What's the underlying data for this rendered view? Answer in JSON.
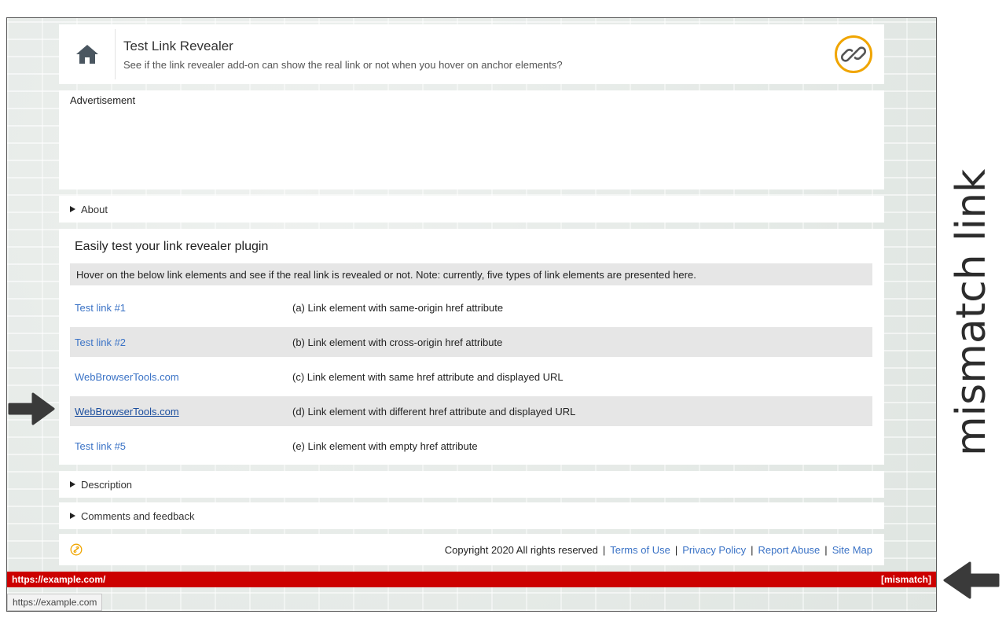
{
  "header": {
    "title": "Test Link Revealer",
    "subtitle": "See if the link revealer add-on can show the real link or not when you hover on anchor elements?",
    "home_icon": "home-icon",
    "logo_icon": "chain-link-icon"
  },
  "advertisement": {
    "label": "Advertisement"
  },
  "about": {
    "label": "About"
  },
  "main": {
    "title": "Easily test your link revealer plugin",
    "note": "Hover on the below link elements and see if the real link is revealed or not. Note: currently, five types of link elements are presented here.",
    "rows": [
      {
        "link": "Test link #1",
        "description": "(a) Link element with same-origin href attribute"
      },
      {
        "link": "Test link #2",
        "description": "(b) Link element with cross-origin href attribute"
      },
      {
        "link": "WebBrowserTools.com",
        "description": "(c) Link element with same href attribute and displayed URL"
      },
      {
        "link": "WebBrowserTools.com",
        "description": "(d) Link element with different href attribute and displayed URL"
      },
      {
        "link": "Test link #5",
        "description": "(e) Link element with empty href attribute"
      }
    ]
  },
  "description": {
    "label": "Description"
  },
  "comments": {
    "label": "Comments and feedback"
  },
  "footer": {
    "copyright": "Copyright 2020 All rights reserved",
    "links": [
      "Terms of Use",
      "Privacy Policy",
      "Report Abuse",
      "Site Map"
    ]
  },
  "status_bar": {
    "url": "https://example.com/",
    "tag": "[mismatch]"
  },
  "browser_tooltip": {
    "url": "https://example.com"
  },
  "annotation": {
    "side_label": "mismatch link"
  },
  "colors": {
    "accent": "#3b73c6",
    "status_bar": "#cc0000",
    "logo": "#f0a500"
  }
}
